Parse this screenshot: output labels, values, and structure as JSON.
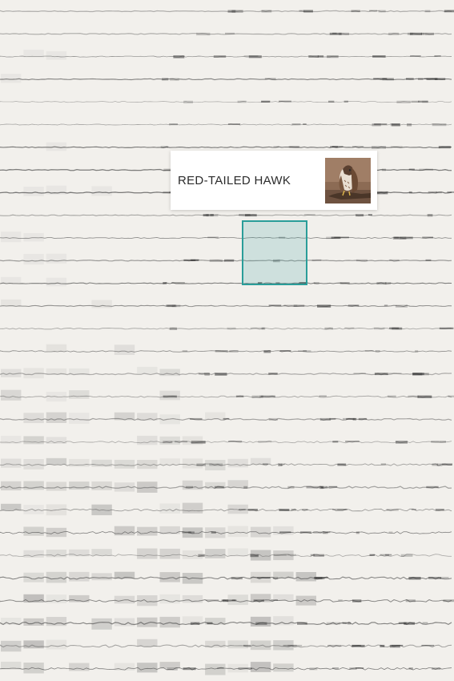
{
  "tooltip": {
    "species_name": "RED-TAILED HAWK",
    "thumbnail_icon": "red-tailed-hawk-photo"
  },
  "colors": {
    "background": "#f2f0ec",
    "highlight_border": "#2a9d99",
    "ink": "#3a3a3a"
  }
}
